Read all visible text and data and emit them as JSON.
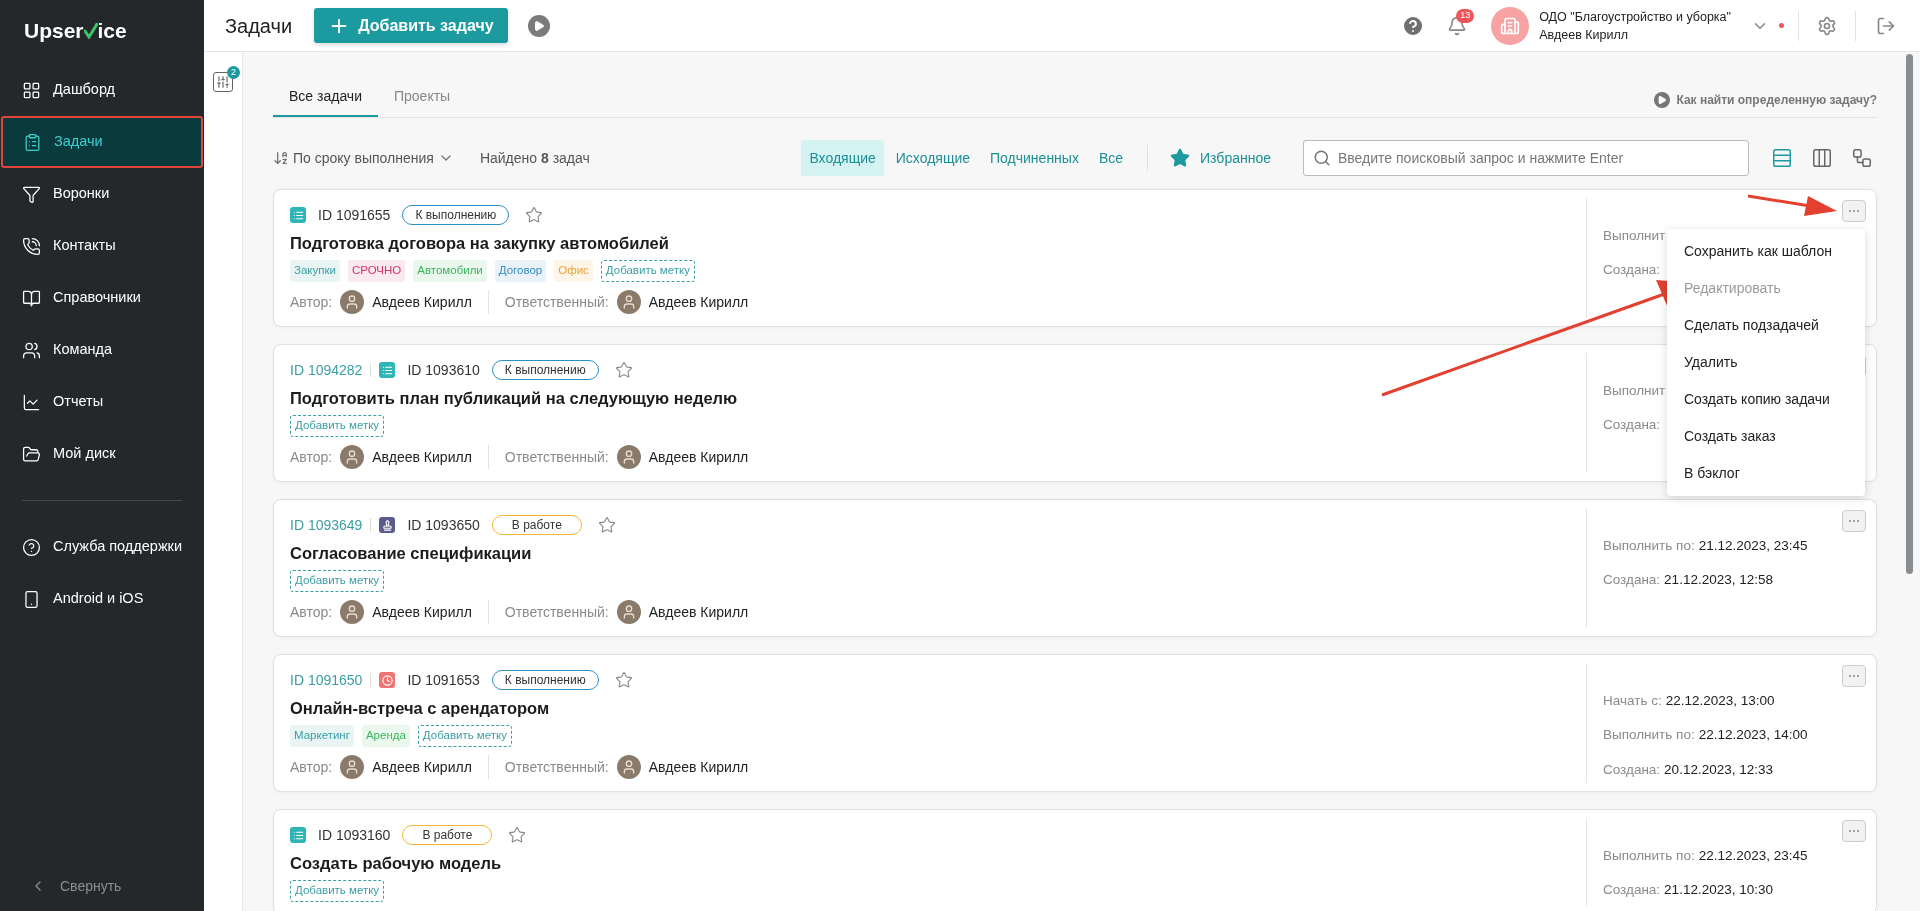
{
  "sidebar": {
    "logo": {
      "before": "Upser",
      "after": "ice"
    },
    "nav": [
      {
        "label": "Дашборд",
        "selected": false
      },
      {
        "label": "Задачи",
        "selected": true
      },
      {
        "label": "Воронки",
        "selected": false
      },
      {
        "label": "Контакты",
        "selected": false
      },
      {
        "label": "Справочники",
        "selected": false
      },
      {
        "label": "Команда",
        "selected": false
      },
      {
        "label": "Отчеты",
        "selected": false
      },
      {
        "label": "Мой диск",
        "selected": false
      }
    ],
    "support": [
      {
        "label": "Служба поддержки"
      },
      {
        "label": "Android и iOS"
      }
    ],
    "collapse": "Свернуть"
  },
  "header": {
    "title": "Задачи",
    "add_button": "Добавить задачу",
    "notifications": "13",
    "company": "ОДО \"Благоустройство и уборка\"",
    "user": "Авдеев Кирилл"
  },
  "filter_badge": "2",
  "tabs": [
    {
      "label": "Все задачи",
      "selected": true
    },
    {
      "label": "Проекты",
      "selected": false
    }
  ],
  "help_link": "Как найти определенную задачу?",
  "toolbar": {
    "sort": "По сроку выполнения",
    "found": "Найдено **8** задач",
    "filters": [
      {
        "label": "Входящие",
        "selected": true
      },
      {
        "label": "Исходящие",
        "selected": false
      },
      {
        "label": "Подчиненных",
        "selected": false
      },
      {
        "label": "Все",
        "selected": false
      }
    ],
    "favorites": "Избранное",
    "search_placeholder": "Введите поисковый запрос и нажмите Enter",
    "views": [
      {
        "kind": "list",
        "selected": true
      },
      {
        "kind": "columns",
        "selected": false
      },
      {
        "kind": "graph",
        "selected": false
      }
    ]
  },
  "tasks": [
    {
      "kind": "list",
      "id": "ID 1091655",
      "status": {
        "label": "К выполнению",
        "color": "#2b8fc4"
      },
      "title": "Подготовка договора на закупку автомобилей",
      "tags": [
        {
          "label": "Закупки",
          "color": "#3a9ea5"
        },
        {
          "label": "СРОЧНО",
          "color": "#d6336c"
        },
        {
          "label": "Автомобили",
          "color": "#3cb55a"
        },
        {
          "label": "Договор",
          "color": "#3a8cc4"
        },
        {
          "label": "Офис",
          "color": "#f0a030"
        }
      ],
      "add_tag": "Добавить метку",
      "author_label": "Автор:",
      "author": "Авдеев Кирилл",
      "assignee_label": "Ответственный:",
      "assignee": "Авдеев Кирилл",
      "dates": [
        {
          "label": "Выполнит"
        },
        {
          "label": "Создана:"
        }
      ],
      "menu_open": true
    },
    {
      "parent_id": "ID 1094282",
      "kind": "list",
      "id": "ID 1093610",
      "status": {
        "label": "К выполнению",
        "color": "#2b8fc4"
      },
      "title": "Подготовить план публикаций на следующую неделю",
      "add_tag": "Добавить метку",
      "author_label": "Автор:",
      "author": "Авдеев Кирилл",
      "assignee_label": "Ответственный:",
      "assignee": "Авдеев Кирилл",
      "dates": [
        {
          "label": "Выполнит"
        },
        {
          "label": "Создана:"
        }
      ],
      "menu_open": false
    },
    {
      "parent_id": "ID 1093649",
      "kind": "approval",
      "id": "ID 1093650",
      "status": {
        "label": "В работе",
        "color": "#f5b731"
      },
      "title": "Согласование спецификации",
      "add_tag": "Добавить метку",
      "author_label": "Автор:",
      "author": "Авдеев Кирилл",
      "assignee_label": "Ответственный:",
      "assignee": "Авдеев Кирилл",
      "dates": [
        {
          "label": "Выполнить по:",
          "value": "21.12.2023, 23:45"
        },
        {
          "label": "Создана:",
          "value": "21.12.2023, 12:58"
        }
      ],
      "menu_open": false
    },
    {
      "parent_id": "ID 1091650",
      "kind": "meeting",
      "id": "ID 1091653",
      "status": {
        "label": "К выполнению",
        "color": "#2b8fc4"
      },
      "title": "Онлайн-встреча с арендатором",
      "tags": [
        {
          "label": "Маркетинг",
          "color": "#3a9ea5"
        },
        {
          "label": "Аренда",
          "color": "#3cb55a"
        }
      ],
      "add_tag": "Добавить метку",
      "author_label": "Автор:",
      "author": "Авдеев Кирилл",
      "assignee_label": "Ответственный:",
      "assignee": "Авдеев Кирилл",
      "dates": [
        {
          "label": "Начать с:",
          "value": "22.12.2023, 13:00"
        },
        {
          "label": "Выполнить по:",
          "value": "22.12.2023, 14:00"
        },
        {
          "label": "Создана:",
          "value": "20.12.2023, 12:33"
        }
      ],
      "menu_open": false
    },
    {
      "kind": "list",
      "id": "ID 1093160",
      "status": {
        "label": "В работе",
        "color": "#f5b731"
      },
      "title": "Создать рабочую модель",
      "add_tag": "Добавить метку",
      "dates": [
        {
          "label": "Выполнить по:",
          "value": "22.12.2023, 23:45"
        },
        {
          "label": "Создана:",
          "value": "21.12.2023, 10:30"
        }
      ],
      "menu_open": false
    }
  ],
  "menu": {
    "items": [
      {
        "label": "Сохранить как шаблон",
        "disabled": false
      },
      {
        "label": "Редактировать",
        "disabled": true
      },
      {
        "label": "Сделать подзадачей",
        "disabled": false
      },
      {
        "label": "Удалить",
        "disabled": false
      },
      {
        "label": "Создать копию задачи",
        "disabled": false
      },
      {
        "label": "Создать заказ",
        "disabled": false
      },
      {
        "label": "В бэклог",
        "disabled": false
      }
    ]
  }
}
